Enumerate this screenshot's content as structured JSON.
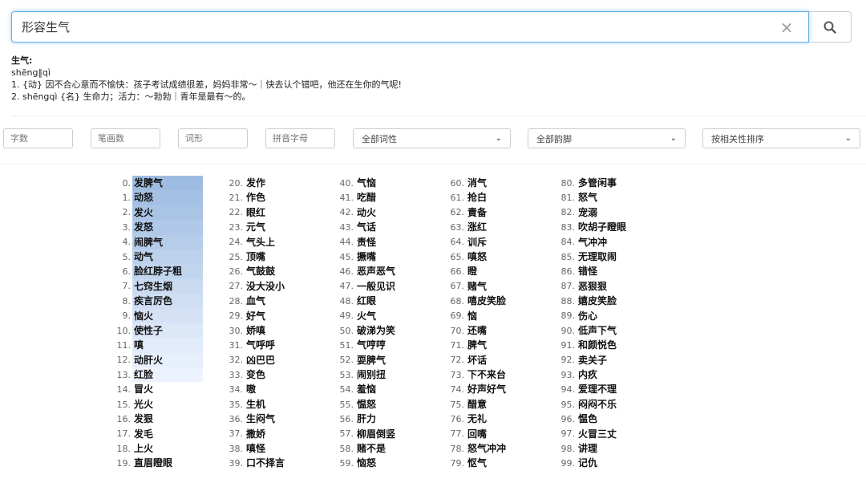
{
  "search": {
    "value": "形容生气",
    "clear_label": "×"
  },
  "definition": {
    "title": "生气:",
    "pinyin": "shēng‖qì",
    "line1": "1. {动} 因不合心意而不愉快：孩子考试成绩很差，妈妈非常～｜快去认个错吧，他还在生你的气呢!",
    "line2": "2. shēngqì {名} 生命力；活力：～勃勃｜青年是最有～的。"
  },
  "filters": {
    "char_count": "字数",
    "stroke_count": "笔画数",
    "word_form": "词形",
    "pinyin_initials": "拼音字母",
    "pos": "全部词性",
    "rhyme": "全部韵脚",
    "sort": "按相关性排序"
  },
  "colors": {
    "highlight_top": "#9ebcf5",
    "highlight_bottom": "#edf3fe",
    "focus_border": "#66afe9"
  },
  "results": [
    [
      "发脾气",
      "动怒",
      "发火",
      "发怒",
      "闹脾气",
      "动气",
      "脸红脖子粗",
      "七窍生烟",
      "疾言厉色",
      "恼火",
      "使性子",
      "嗔",
      "动肝火",
      "红脸",
      "冒火",
      "光火",
      "发狠",
      "发毛",
      "上火",
      "直眉瞪眼"
    ],
    [
      "发作",
      "作色",
      "眼红",
      "元气",
      "气头上",
      "顶嘴",
      "气鼓鼓",
      "没大没小",
      "血气",
      "好气",
      "娇嗔",
      "气呼呼",
      "凶巴巴",
      "变色",
      "嗷",
      "生机",
      "生闷气",
      "撒娇",
      "嗔怪",
      "口不择言"
    ],
    [
      "气恼",
      "吃醋",
      "动火",
      "气话",
      "责怪",
      "撅嘴",
      "恶声恶气",
      "一般见识",
      "红眼",
      "火气",
      "破涕为笑",
      "气哼哼",
      "耍脾气",
      "闹别扭",
      "羞恼",
      "愠怒",
      "肝力",
      "柳眉倒竖",
      "赌不是",
      "恼怒"
    ],
    [
      "消气",
      "抢白",
      "責备",
      "涨红",
      "训斥",
      "嗔怒",
      "瞪",
      "赌气",
      "嘻皮笑脸",
      "恼",
      "还嘴",
      "脾气",
      "坏话",
      "下不来台",
      "好声好气",
      "醋意",
      "无礼",
      "回嘴",
      "怒气冲冲",
      "怄气"
    ],
    [
      "多管闲事",
      "怒气",
      "宠溺",
      "吹胡子瞪眼",
      "气冲冲",
      "无理取闹",
      "错怪",
      "恶狠狠",
      "嬉皮笑脸",
      "伤心",
      "低声下气",
      "和颜悦色",
      "卖关子",
      "内疚",
      "爱理不理",
      "闷闷不乐",
      "愠色",
      "火冒三丈",
      "讲理",
      "记仇"
    ]
  ]
}
